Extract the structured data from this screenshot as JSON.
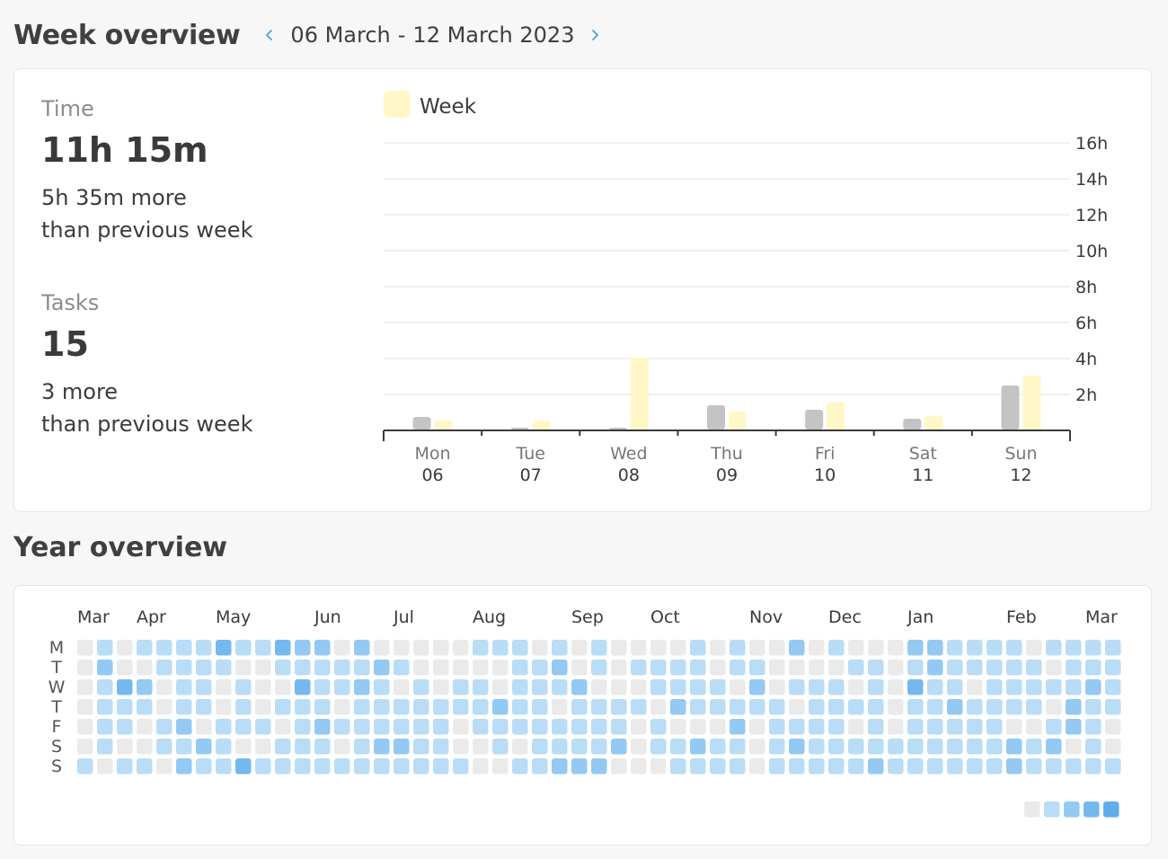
{
  "week": {
    "title": "Week overview",
    "prev_icon": "chevron-left-icon",
    "next_icon": "chevron-right-icon",
    "range_start": "06 March",
    "range_sep": "-",
    "range_end": "12 March 2023",
    "time": {
      "label": "Time",
      "value": "11h 15m",
      "diff_line1": "5h 35m more",
      "diff_line2": "than previous week"
    },
    "tasks": {
      "label": "Tasks",
      "value": "15",
      "diff_line1": "3 more",
      "diff_line2": "than previous week"
    }
  },
  "chart_data": {
    "type": "bar",
    "legend": "Week",
    "legend_position": "top-left",
    "y_tick_labels": [
      "2h",
      "4h",
      "6h",
      "8h",
      "10h",
      "12h",
      "14h",
      "16h"
    ],
    "ylim": [
      0,
      16
    ],
    "grid": true,
    "categories": [
      {
        "day": "Mon",
        "date": "06"
      },
      {
        "day": "Tue",
        "date": "07"
      },
      {
        "day": "Wed",
        "date": "08"
      },
      {
        "day": "Thu",
        "date": "09"
      },
      {
        "day": "Fri",
        "date": "10"
      },
      {
        "day": "Sat",
        "date": "11"
      },
      {
        "day": "Sun",
        "date": "12"
      }
    ],
    "series": [
      {
        "color": "#c4c4c4",
        "values": [
          0.7,
          0.1,
          0.1,
          1.35,
          1.1,
          0.6,
          2.45
        ]
      },
      {
        "name": "Week",
        "color": "#fff7c7",
        "values": [
          0.5,
          0.5,
          4.0,
          1.0,
          1.5,
          0.75,
          3.0
        ]
      }
    ]
  },
  "year": {
    "title": "Year overview",
    "months": [
      "Mar",
      "Apr",
      "May",
      "Jun",
      "Jul",
      "Aug",
      "Sep",
      "Oct",
      "Nov",
      "Dec",
      "Jan",
      "Feb",
      "Mar"
    ],
    "month_start_weeks": [
      0,
      3,
      7,
      12,
      16,
      20,
      25,
      29,
      34,
      38,
      42,
      47,
      51
    ],
    "day_labels": [
      "M",
      "T",
      "W",
      "T",
      "F",
      "S",
      "S"
    ],
    "levels": [
      "0,1,0,1,1,1,1,3,1,1,3,2,2,0,2,0,0,0,0,0,1,1,1,0,1,0,1,0,0,0,0,1,0,1,0,0,2,0,1,0,0,0,2,2,1,1,1,1,0,1,1,1,1",
      "0,2,0,0,1,1,1,1,0,0,1,1,1,1,1,2,1,0,0,0,0,0,1,1,2,0,1,0,1,1,1,1,0,1,1,0,0,0,0,1,1,0,1,2,1,1,1,1,1,0,1,1,1",
      "0,1,3,2,0,1,1,0,1,0,0,3,1,1,2,1,0,1,0,1,1,0,1,1,1,2,0,0,0,1,1,1,1,0,2,0,1,1,1,0,1,0,3,1,1,0,1,1,1,1,1,2,1",
      "0,1,1,1,0,1,1,0,1,0,1,1,1,0,1,1,1,1,1,1,1,2,1,1,0,1,1,1,1,0,2,1,1,1,1,1,0,1,1,1,1,0,1,1,2,1,1,1,1,0,2,1,1",
      "0,1,1,0,1,2,0,1,1,1,0,1,2,1,1,1,1,1,1,0,1,1,1,1,1,1,1,1,0,1,0,0,0,2,0,1,1,1,1,0,1,0,1,1,1,1,1,0,0,1,2,1,0",
      "0,1,0,0,1,1,2,1,0,0,1,1,1,0,1,2,2,1,1,0,0,1,0,1,1,1,1,2,0,1,1,2,1,1,0,1,2,1,1,1,1,1,1,1,1,1,1,2,1,2,0,1,0",
      "1,0,1,1,0,2,1,1,3,1,1,1,1,1,1,1,1,1,1,1,0,0,1,1,2,2,2,0,0,0,1,1,1,1,0,1,1,1,1,1,2,1,1,1,1,1,1,2,1,1,1,1,1"
    ]
  },
  "legend_colors": [
    "#eaeaea",
    "#b9dcf7",
    "#93c9f3",
    "#75b8ee",
    "#5eaeea"
  ],
  "colors": {
    "accent": "#4aa0de",
    "bar_previous": "#c4c4c4",
    "bar_current": "#fff7c7"
  }
}
